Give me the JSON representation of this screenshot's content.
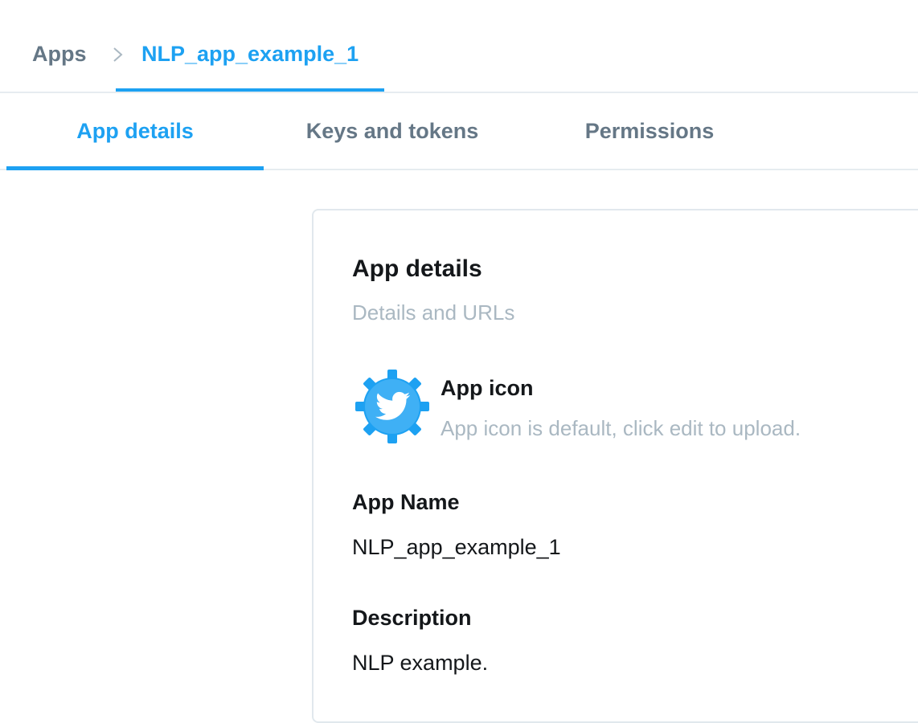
{
  "breadcrumb": {
    "root": "Apps",
    "separator_icon": "chevron-right-icon",
    "current": "NLP_app_example_1"
  },
  "tabs": [
    {
      "label": "App details",
      "active": true
    },
    {
      "label": "Keys and tokens",
      "active": false
    },
    {
      "label": "Permissions",
      "active": false
    }
  ],
  "card": {
    "title": "App details",
    "subtitle": "Details and URLs",
    "app_icon": {
      "icon": "twitter-gear-icon",
      "label": "App icon",
      "hint": "App icon is default, click edit to upload."
    },
    "fields": [
      {
        "label": "App Name",
        "value": "NLP_app_example_1"
      },
      {
        "label": "Description",
        "value": "NLP example."
      }
    ]
  },
  "colors": {
    "accent": "#1da1f2",
    "muted_text": "#657786",
    "subtle_text": "#aab8c2",
    "border": "#e6ecf0"
  }
}
